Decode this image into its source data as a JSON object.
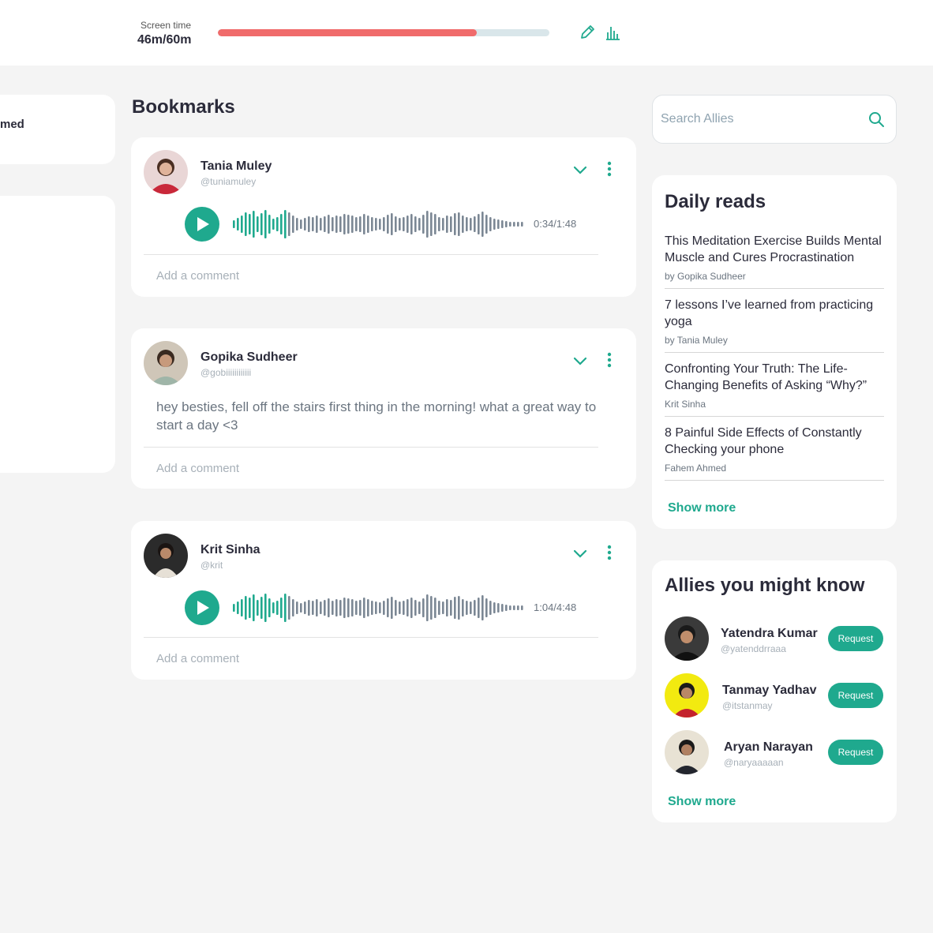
{
  "topbar": {
    "screen_time_label": "Screen time",
    "screen_time_value": "46m/60m",
    "screen_time_progress": 0.78,
    "edit_icon": "pencil-icon",
    "stats_icon": "bar-chart-icon"
  },
  "left": {
    "card1_text": "med"
  },
  "page_title": "Bookmarks",
  "posts": [
    {
      "name": "Tania Muley",
      "handle": "@tuniamuley",
      "type": "audio",
      "time": "0:34/1:48",
      "played_bars": 14,
      "comment_placeholder": "Add a comment"
    },
    {
      "name": "Gopika Sudheer",
      "handle": "@gobiiiiiiiiiiii",
      "type": "text",
      "text": "hey besties, fell off the stairs first thing in the morning! what a great way to start a day <3",
      "comment_placeholder": "Add a comment"
    },
    {
      "name": "Krit Sinha",
      "handle": "@krit",
      "type": "audio",
      "time": "1:04/4:48",
      "played_bars": 14,
      "comment_placeholder": "Add a comment"
    }
  ],
  "search": {
    "placeholder": "Search Allies"
  },
  "daily_reads": {
    "title": "Daily reads",
    "items": [
      {
        "title": "This Meditation Exercise Builds Mental Muscle and Cures Procrastination",
        "author": "by Gopika Sudheer"
      },
      {
        "title": "7 lessons I’ve learned from practicing yoga",
        "author": "by Tania Muley"
      },
      {
        "title": "Confronting Your Truth: The Life-Changing Benefits of Asking “Why?”",
        "author": "Krit Sinha"
      },
      {
        "title": "8 Painful Side Effects of Constantly Checking your phone",
        "author": "Fahem Ahmed"
      }
    ],
    "show_more": "Show more"
  },
  "allies": {
    "title": "Allies you might know",
    "items": [
      {
        "name": "Yatendra Kumar",
        "handle": "@yatenddrraaa",
        "button": "Request"
      },
      {
        "name": "Tanmay Yadhav",
        "handle": "@itstanmay",
        "button": "Request"
      },
      {
        "name": "Aryan Narayan",
        "handle": "@naryaaaaan",
        "button": "Request"
      }
    ],
    "show_more": "Show more"
  },
  "colors": {
    "accent": "#1fa98e",
    "progress": "#f06b6b",
    "waveform_unplayed": "#7b8794"
  }
}
